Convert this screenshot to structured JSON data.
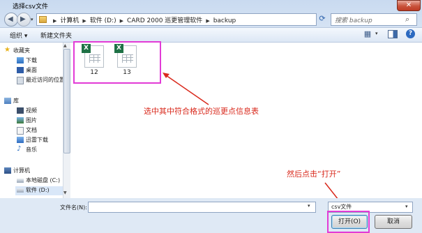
{
  "window": {
    "title": "选择csv文件",
    "close_glyph": "✕"
  },
  "nav": {
    "back_icon": "back-arrow-icon",
    "forward_icon": "forward-arrow-icon",
    "breadcrumbs": [
      "计算机",
      "软件 (D:)",
      "CARD 2000 巡更管理软件",
      "backup"
    ],
    "search_placeholder": "搜索 backup"
  },
  "toolbar": {
    "organize": "组织 ▾",
    "new_folder": "新建文件夹"
  },
  "sidebar": {
    "favorites": {
      "label": "收藏夹",
      "items": [
        "下载",
        "桌面",
        "最近访问的位置"
      ]
    },
    "libraries": {
      "label": "库",
      "items": [
        "视频",
        "图片",
        "文档",
        "迅雷下载",
        "音乐"
      ]
    },
    "computer": {
      "label": "计算机",
      "items": [
        "本地磁盘 (C:)",
        "软件 (D:)"
      ]
    }
  },
  "files": [
    {
      "name": "12",
      "icon": "excel-csv-icon"
    },
    {
      "name": "13",
      "icon": "excel-csv-icon"
    }
  ],
  "annotations": {
    "select_hint": "选中其中符合格式的巡更点信息表",
    "open_hint": "然后点击“打开”",
    "color": "#d9291c",
    "highlight_color": "#e23bd6"
  },
  "bottom": {
    "filename_label": "文件名(N):",
    "filename_value": "",
    "file_type": "csv文件",
    "open_button": "打开(O)",
    "cancel_button": "取消"
  }
}
